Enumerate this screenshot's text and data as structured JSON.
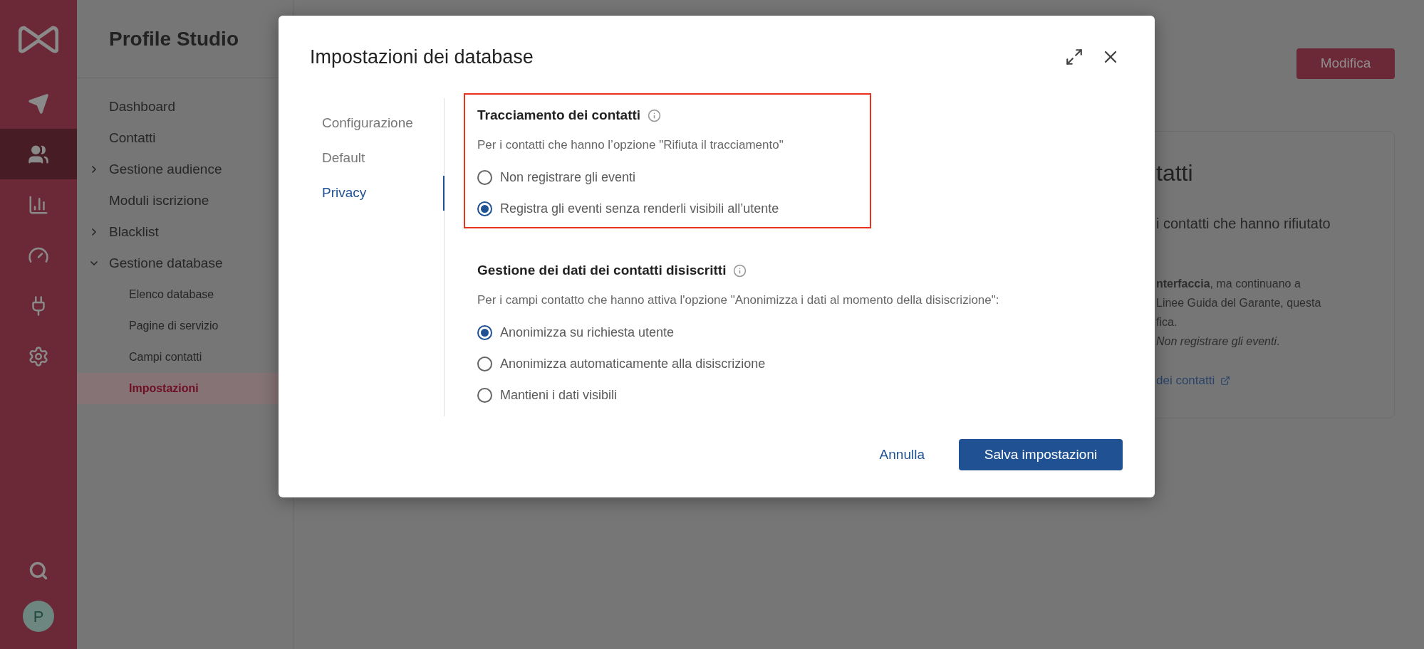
{
  "rail": {
    "items": [
      {
        "selected": false
      },
      {
        "selected": true
      },
      {
        "selected": false
      },
      {
        "selected": false
      },
      {
        "selected": false
      },
      {
        "selected": false
      }
    ],
    "avatar": "P"
  },
  "sidebar": {
    "title": "Profile Studio",
    "items": [
      {
        "label": "Dashboard",
        "selected": false
      },
      {
        "label": "Contatti",
        "selected": false
      },
      {
        "label": "Gestione audience",
        "selected": false,
        "expanded": false
      },
      {
        "label": "Moduli iscrizione",
        "selected": false
      },
      {
        "label": "Blacklist",
        "selected": false,
        "expanded": false
      },
      {
        "label": "Gestione database",
        "selected": false,
        "expanded": true,
        "children": [
          {
            "label": "Elenco database",
            "selected": false
          },
          {
            "label": "Pagine di servizio",
            "selected": false
          },
          {
            "label": "Campi contatti",
            "selected": false
          },
          {
            "label": "Impostazioni",
            "selected": true
          }
        ]
      }
    ]
  },
  "background": {
    "edit_button": "Modifica",
    "card": {
      "heading": "tatti",
      "subtitle": "i contatti che hanno rifiutato",
      "paragraph_lines": [
        "**nterfaccia**, ma continuano a",
        "Linee Guida del Garante, questa",
        "fica.",
        "*Non registrare gli eventi*."
      ],
      "link": "dei contatti"
    }
  },
  "modal": {
    "title": "Impostazioni dei database",
    "tabs": [
      {
        "label": "Configurazione",
        "selected": false
      },
      {
        "label": "Default",
        "selected": false
      },
      {
        "label": "Privacy",
        "selected": true
      }
    ],
    "sections": [
      {
        "title": "Tracciamento dei contatti",
        "highlighted": true,
        "description": "Per i contatti che hanno l’opzione \"Rifiuta il tracciamento\"",
        "options": [
          {
            "label": "Non registrare gli eventi",
            "selected": false
          },
          {
            "label": "Registra gli eventi senza renderli visibili all’utente",
            "selected": true
          }
        ]
      },
      {
        "title": "Gestione dei dati dei contatti disiscritti",
        "description": "Per i campi contatto che hanno attiva l'opzione \"Anonimizza i dati al momento della disiscrizione\":",
        "options": [
          {
            "label": "Anonimizza su richiesta utente",
            "selected": true
          },
          {
            "label": "Anonimizza automaticamente alla disiscrizione",
            "selected": false
          },
          {
            "label": "Mantieni i dati visibili",
            "selected": false
          }
        ]
      }
    ],
    "cancel": "Annulla",
    "save": "Salva impostazioni"
  }
}
